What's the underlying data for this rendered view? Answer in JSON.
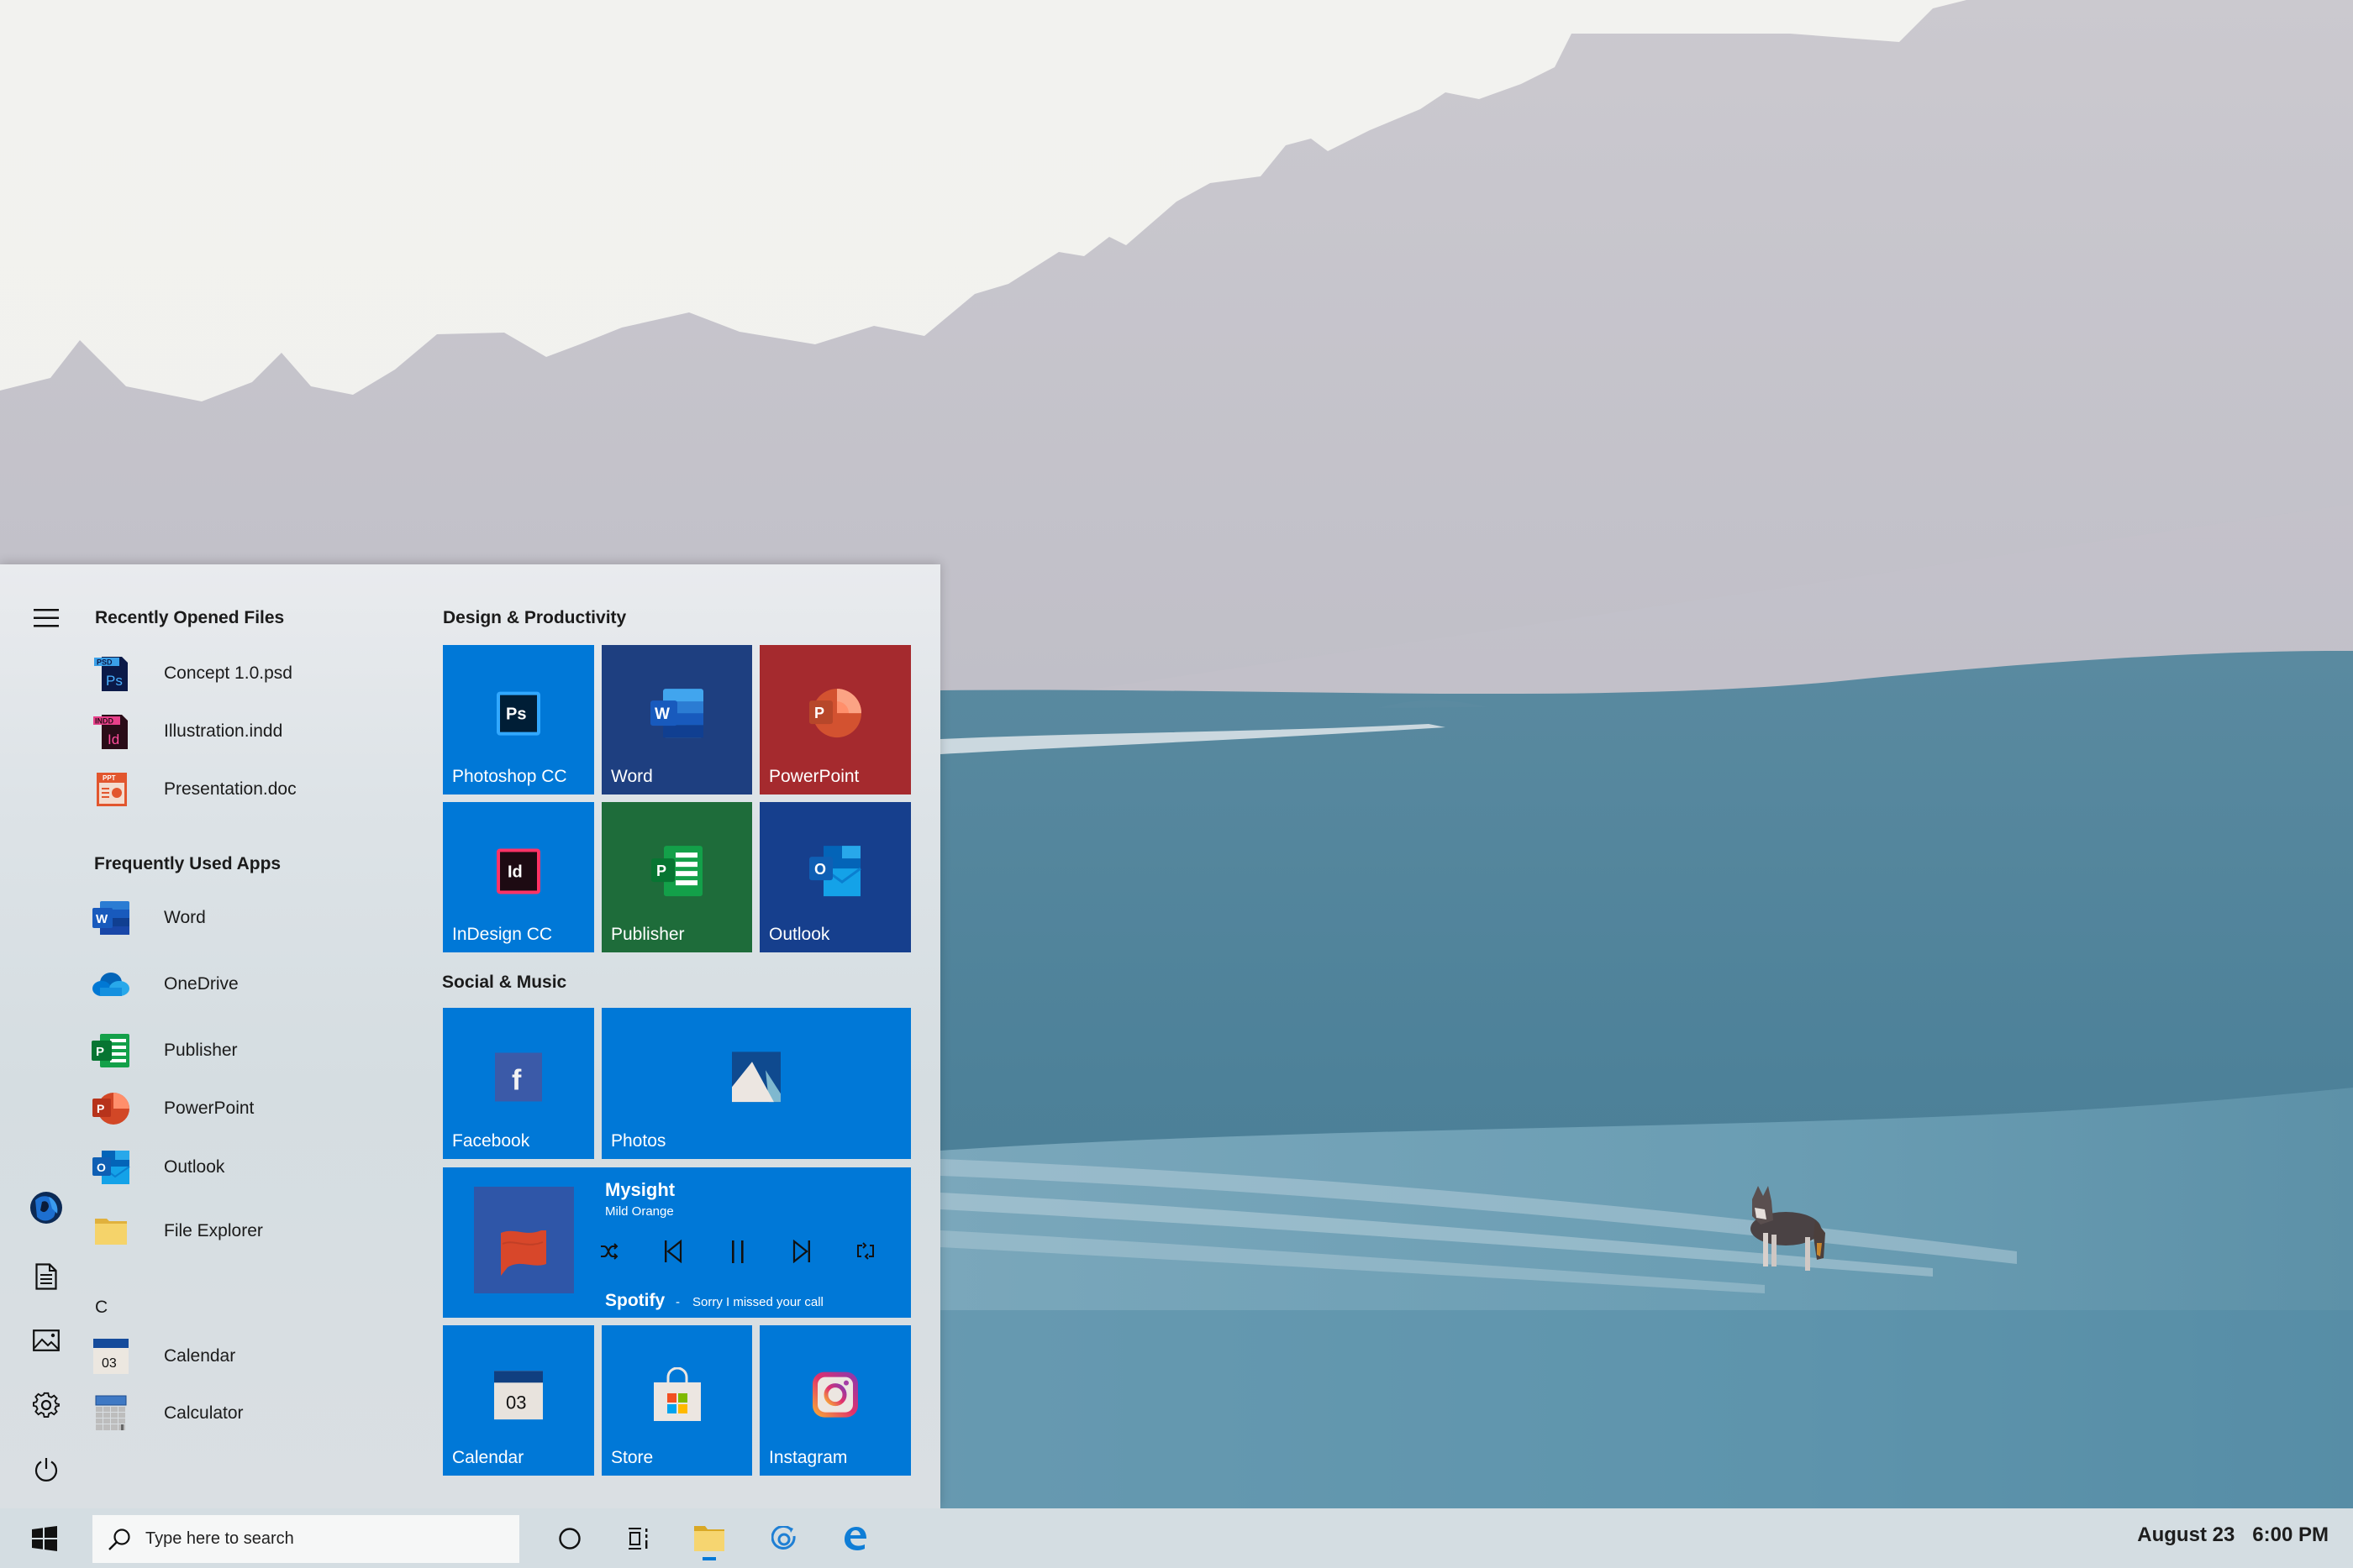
{
  "start_menu": {
    "rail": {
      "menu_icon": "hamburger-menu-icon",
      "avatar": "user-avatar",
      "items": [
        {
          "name": "documents",
          "icon": "document-icon"
        },
        {
          "name": "pictures",
          "icon": "pictures-icon"
        },
        {
          "name": "settings",
          "icon": "gear-icon"
        },
        {
          "name": "power",
          "icon": "power-icon"
        }
      ]
    },
    "recent_files": {
      "heading": "Recently Opened Files",
      "items": [
        {
          "label": "Concept 1.0.psd",
          "icon": "psd-file-icon",
          "badge": "PSD",
          "glyph": "Ps"
        },
        {
          "label": "Illustration.indd",
          "icon": "indd-file-icon",
          "badge": "INDD",
          "glyph": "Id"
        },
        {
          "label": "Presentation.doc",
          "icon": "ppt-file-icon",
          "badge": "PPT"
        }
      ]
    },
    "frequent_apps": {
      "heading": "Frequently Used Apps",
      "items": [
        {
          "label": "Word",
          "icon": "word-icon"
        },
        {
          "label": "OneDrive",
          "icon": "onedrive-icon"
        },
        {
          "label": "Publisher",
          "icon": "publisher-icon"
        },
        {
          "label": "PowerPoint",
          "icon": "powerpoint-icon"
        },
        {
          "label": "Outlook",
          "icon": "outlook-icon"
        },
        {
          "label": "File Explorer",
          "icon": "folder-icon"
        }
      ]
    },
    "alpha_list": {
      "letter": "C",
      "items": [
        {
          "label": "Calendar",
          "icon": "calendar-icon",
          "day": "03"
        },
        {
          "label": "Calculator",
          "icon": "calculator-icon"
        }
      ]
    },
    "tile_groups": [
      {
        "heading": "Design & Productivity",
        "tiles": [
          {
            "label": "Photoshop CC",
            "icon": "photoshop-icon",
            "glyph": "Ps",
            "color": "#0078d7"
          },
          {
            "label": "Word",
            "icon": "word-icon",
            "glyph": "W",
            "color": "#1e3f80"
          },
          {
            "label": "PowerPoint",
            "icon": "powerpoint-icon",
            "glyph": "P",
            "color": "#a52a2e"
          },
          {
            "label": "InDesign CC",
            "icon": "indesign-icon",
            "glyph": "Id",
            "color": "#0078d7"
          },
          {
            "label": "Publisher",
            "icon": "publisher-icon",
            "glyph": "P",
            "color": "#1e6c3a"
          },
          {
            "label": "Outlook",
            "icon": "outlook-icon",
            "glyph": "O",
            "color": "#163f8d"
          }
        ]
      },
      {
        "heading": "Social & Music",
        "tiles": [
          {
            "label": "Facebook",
            "icon": "facebook-icon",
            "glyph": "f",
            "color": "#0078d7"
          },
          {
            "label": "Photos",
            "icon": "photos-icon",
            "color": "#0078d7"
          }
        ],
        "player": {
          "title": "Mysight",
          "artist": "Mild Orange",
          "source": "Spotify",
          "separator": "-",
          "status": "Sorry I missed your call",
          "color": "#0078d7",
          "controls": [
            {
              "name": "shuffle",
              "icon": "shuffle-icon"
            },
            {
              "name": "previous",
              "icon": "previous-track-icon"
            },
            {
              "name": "pause",
              "icon": "pause-icon"
            },
            {
              "name": "next",
              "icon": "next-track-icon"
            },
            {
              "name": "repeat",
              "icon": "repeat-icon"
            }
          ]
        },
        "bottom_tiles": [
          {
            "label": "Calendar",
            "icon": "calendar-icon",
            "day": "03",
            "color": "#0078d7"
          },
          {
            "label": "Store",
            "icon": "store-icon",
            "color": "#0078d7"
          },
          {
            "label": "Instagram",
            "icon": "instagram-icon",
            "color": "#0078d7"
          }
        ]
      }
    ]
  },
  "taskbar": {
    "start_icon": "windows-logo-icon",
    "search": {
      "placeholder": "Type here to search",
      "value": ""
    },
    "pinned": [
      {
        "name": "cortana",
        "icon": "cortana-circle-icon",
        "active": false
      },
      {
        "name": "task-view",
        "icon": "task-view-icon",
        "active": false
      },
      {
        "name": "file-explorer",
        "icon": "folder-icon",
        "active": true
      },
      {
        "name": "groove-music",
        "icon": "groove-music-icon",
        "active": false
      },
      {
        "name": "edge",
        "icon": "edge-icon",
        "active": false
      }
    ],
    "clock": {
      "date": "August 23",
      "time": "6:00 PM"
    },
    "accent": "#0078d7"
  }
}
